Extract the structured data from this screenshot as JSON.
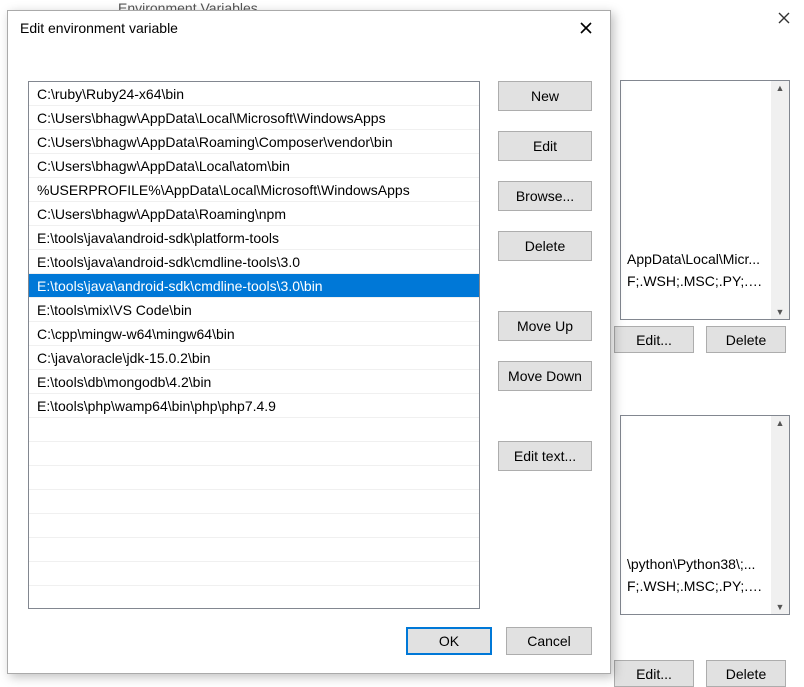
{
  "parentDialog": {
    "title": "Environment Variables",
    "list1": {
      "line1": "AppData\\Local\\Micr...",
      "line2": "F;.WSH;.MSC;.PY;.PY..."
    },
    "list2": {
      "line1": "\\python\\Python38\\;...",
      "line2": "F;.WSH;.MSC;.PY;.PYW"
    },
    "buttons": {
      "edit": "Edit...",
      "delete": "Delete"
    }
  },
  "dialog": {
    "title": "Edit environment variable",
    "paths": [
      "C:\\ruby\\Ruby24-x64\\bin",
      "C:\\Users\\bhagw\\AppData\\Local\\Microsoft\\WindowsApps",
      "C:\\Users\\bhagw\\AppData\\Roaming\\Composer\\vendor\\bin",
      "C:\\Users\\bhagw\\AppData\\Local\\atom\\bin",
      "%USERPROFILE%\\AppData\\Local\\Microsoft\\WindowsApps",
      "C:\\Users\\bhagw\\AppData\\Roaming\\npm",
      "E:\\tools\\java\\android-sdk\\platform-tools",
      "E:\\tools\\java\\android-sdk\\cmdline-tools\\3.0",
      "E:\\tools\\java\\android-sdk\\cmdline-tools\\3.0\\bin",
      "E:\\tools\\mix\\VS Code\\bin",
      "C:\\cpp\\mingw-w64\\mingw64\\bin",
      "C:\\java\\oracle\\jdk-15.0.2\\bin",
      "E:\\tools\\db\\mongodb\\4.2\\bin",
      "E:\\tools\\php\\wamp64\\bin\\php\\php7.4.9"
    ],
    "selectedIndex": 8,
    "sideButtons": {
      "new": "New",
      "edit": "Edit",
      "browse": "Browse...",
      "delete": "Delete",
      "moveUp": "Move Up",
      "moveDown": "Move Down",
      "editText": "Edit text..."
    },
    "footer": {
      "ok": "OK",
      "cancel": "Cancel"
    }
  }
}
